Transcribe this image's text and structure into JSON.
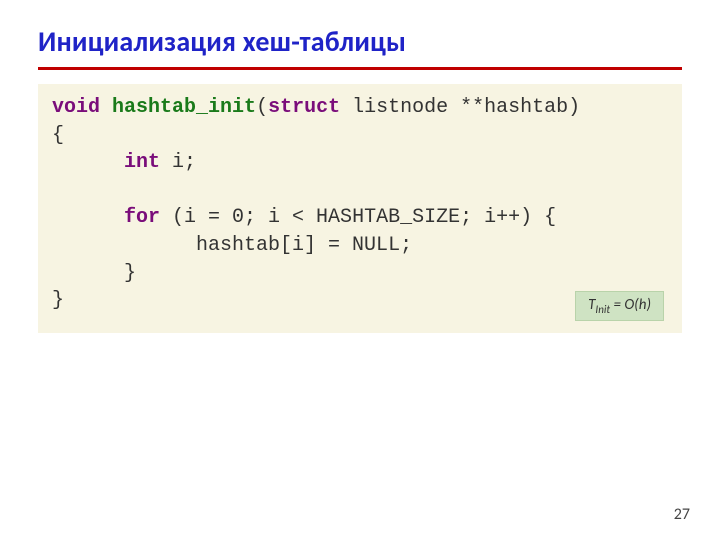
{
  "title": "Инициализация хеш-таблицы",
  "code": {
    "kw_void": "void",
    "fn_name": "hashtab_init",
    "sig_open": "(",
    "kw_struct": "struct",
    "sig_rest": " listnode **hashtab)",
    "brace_open": "{",
    "indent1": "      ",
    "kw_int": "int",
    "decl_i": " i;",
    "blank": "",
    "kw_for": "for",
    "for_body": " (i = 0; i < HASHTAB_SIZE; i++) {",
    "indent2": "            ",
    "assign": "hashtab[i] = NULL;",
    "brace_close_inner": "      }",
    "brace_close_outer": "}"
  },
  "complexity": {
    "T": "T",
    "sub": "Init",
    "eq": " = ",
    "O": "O",
    "open": "(",
    "h": "h",
    "close": ")"
  },
  "page_number": "27"
}
